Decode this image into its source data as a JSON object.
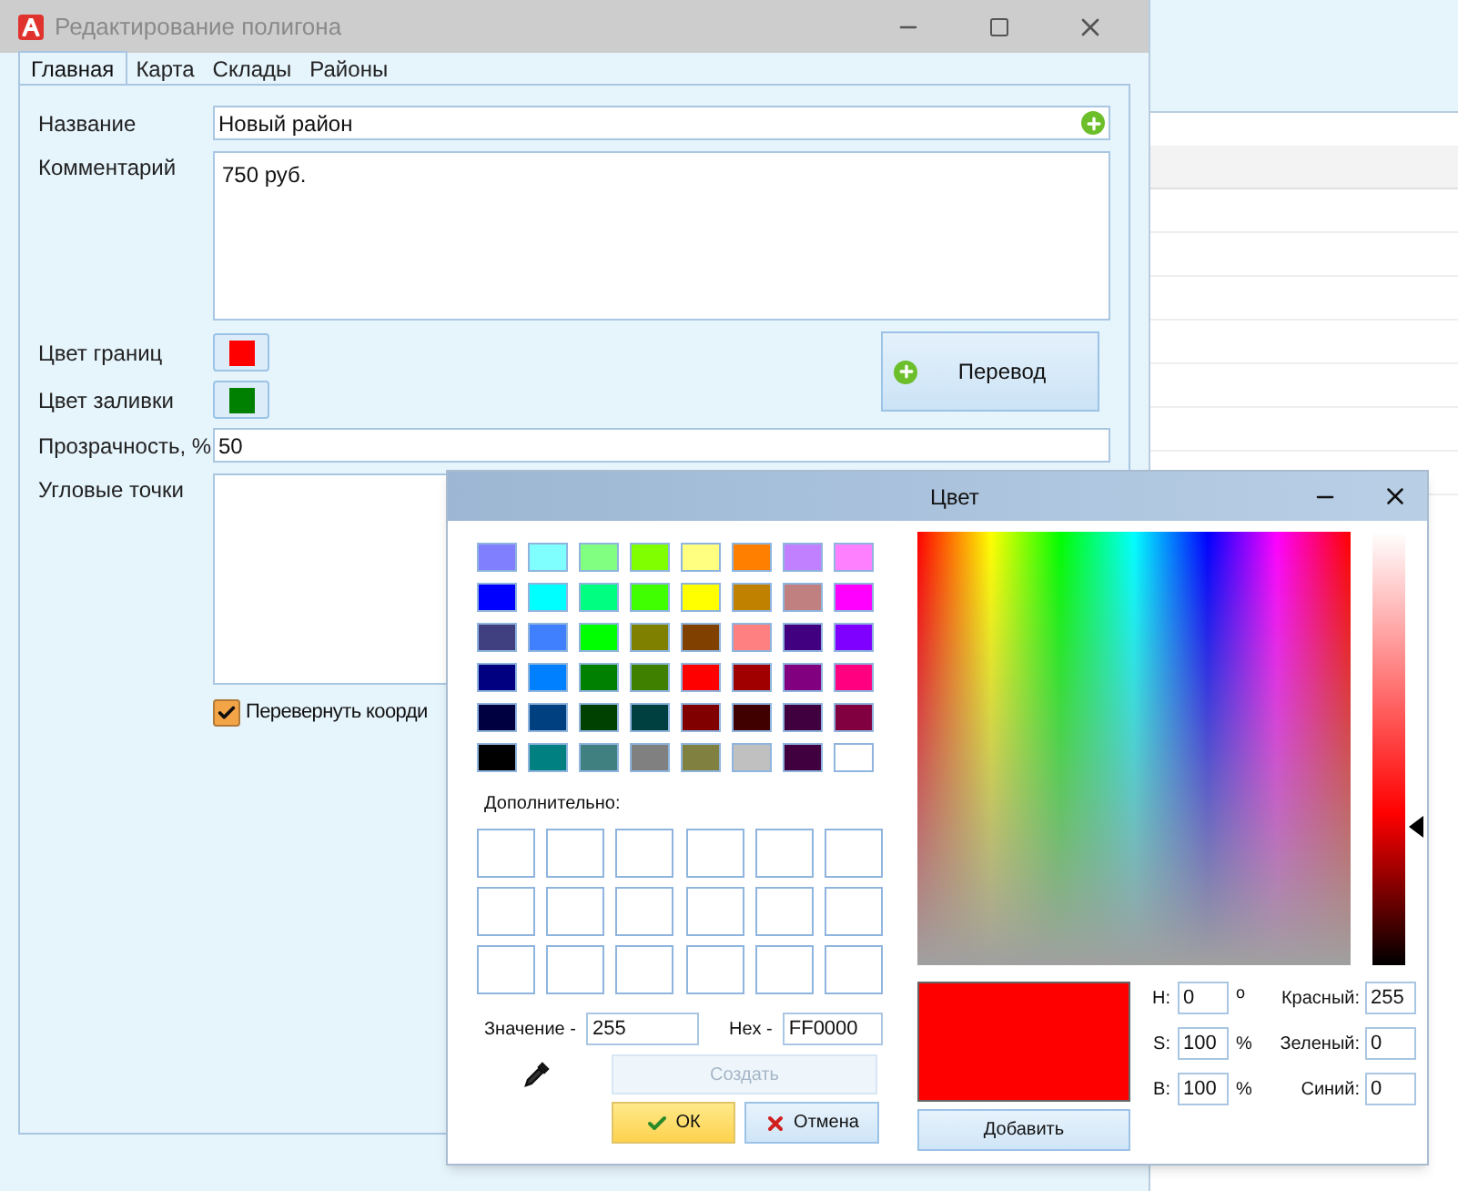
{
  "window": {
    "title": "Редактирование полигона"
  },
  "tabs": [
    {
      "label": "Главная",
      "selected": true
    },
    {
      "label": "Карта",
      "selected": false
    },
    {
      "label": "Склады",
      "selected": false
    },
    {
      "label": "Районы",
      "selected": false
    }
  ],
  "form": {
    "name": {
      "label": "Название",
      "value": "Новый район"
    },
    "comment": {
      "label": "Комментарий",
      "value": "750 руб."
    },
    "border_color": {
      "label": "Цвет границ",
      "color": "#ff0000"
    },
    "fill_color": {
      "label": "Цвет заливки",
      "color": "#008000"
    },
    "translate_button": "Перевод",
    "transparency": {
      "label": "Прозрачность, %",
      "value": "50"
    },
    "corner_points": {
      "label": "Угловые точки"
    },
    "flip_checkbox": {
      "label": "Перевернуть коорди",
      "checked": true
    }
  },
  "color_dialog": {
    "title": "Цвет",
    "swatches": [
      [
        {
          "color": "#8080ff"
        },
        {
          "color": "#80ffff"
        },
        {
          "color": "#80ff80"
        },
        {
          "color": "#80ff00"
        },
        {
          "color": "#ffff80"
        },
        {
          "color": "#ff8000"
        },
        {
          "color": "#c080ff"
        },
        {
          "color": "#ff80ff"
        }
      ],
      [
        {
          "color": "#0000ff"
        },
        {
          "color": "#00ffff"
        },
        {
          "color": "#00ff80"
        },
        {
          "color": "#40ff00"
        },
        {
          "color": "#ffff00"
        },
        {
          "color": "#c08000"
        },
        {
          "color": "#c08080"
        },
        {
          "color": "#ff00ff"
        }
      ],
      [
        {
          "color": "#404080"
        },
        {
          "color": "#4080ff"
        },
        {
          "color": "#00ff00"
        },
        {
          "color": "#808000"
        },
        {
          "color": "#804000"
        },
        {
          "color": "#ff8080"
        },
        {
          "color": "#400080"
        },
        {
          "color": "#8000ff"
        }
      ],
      [
        {
          "color": "#000080"
        },
        {
          "color": "#0080ff"
        },
        {
          "color": "#008000"
        },
        {
          "color": "#408000"
        },
        {
          "color": "#ff0000"
        },
        {
          "color": "#a00000"
        },
        {
          "color": "#800080"
        },
        {
          "color": "#ff0080"
        }
      ],
      [
        {
          "color": "#000040"
        },
        {
          "color": "#004080"
        },
        {
          "color": "#004000"
        },
        {
          "color": "#004040"
        },
        {
          "color": "#800000"
        },
        {
          "color": "#400000"
        },
        {
          "color": "#400040"
        },
        {
          "color": "#800040"
        }
      ],
      [
        {
          "color": "#000000"
        },
        {
          "color": "#008080"
        },
        {
          "color": "#408080"
        },
        {
          "color": "#808080"
        },
        {
          "color": "#808040"
        },
        {
          "color": "#c0c0c0"
        },
        {
          "color": "#400040"
        },
        {
          "color": "#ffffff"
        }
      ]
    ],
    "custom_label": "Дополнительно:",
    "value_label": "Значение -",
    "value": "255",
    "hex_label": "Hex -",
    "hex": "FF0000",
    "create_button": {
      "label": "Создать",
      "disabled": true
    },
    "ok_button": "ОК",
    "cancel_button": "Отмена",
    "brightness": {
      "level": 0.32
    },
    "preview": {
      "color": "#ff0000"
    },
    "add_button": "Добавить",
    "hsb": [
      {
        "label": "H:",
        "value": "0",
        "unit": "о"
      },
      {
        "label": "S:",
        "value": "100",
        "unit": "%"
      },
      {
        "label": "B:",
        "value": "100",
        "unit": "%"
      }
    ],
    "rgb": [
      {
        "label": "Красный:",
        "value": "255"
      },
      {
        "label": "Зеленый:",
        "value": "0"
      },
      {
        "label": "Синий:",
        "value": "0"
      }
    ]
  }
}
